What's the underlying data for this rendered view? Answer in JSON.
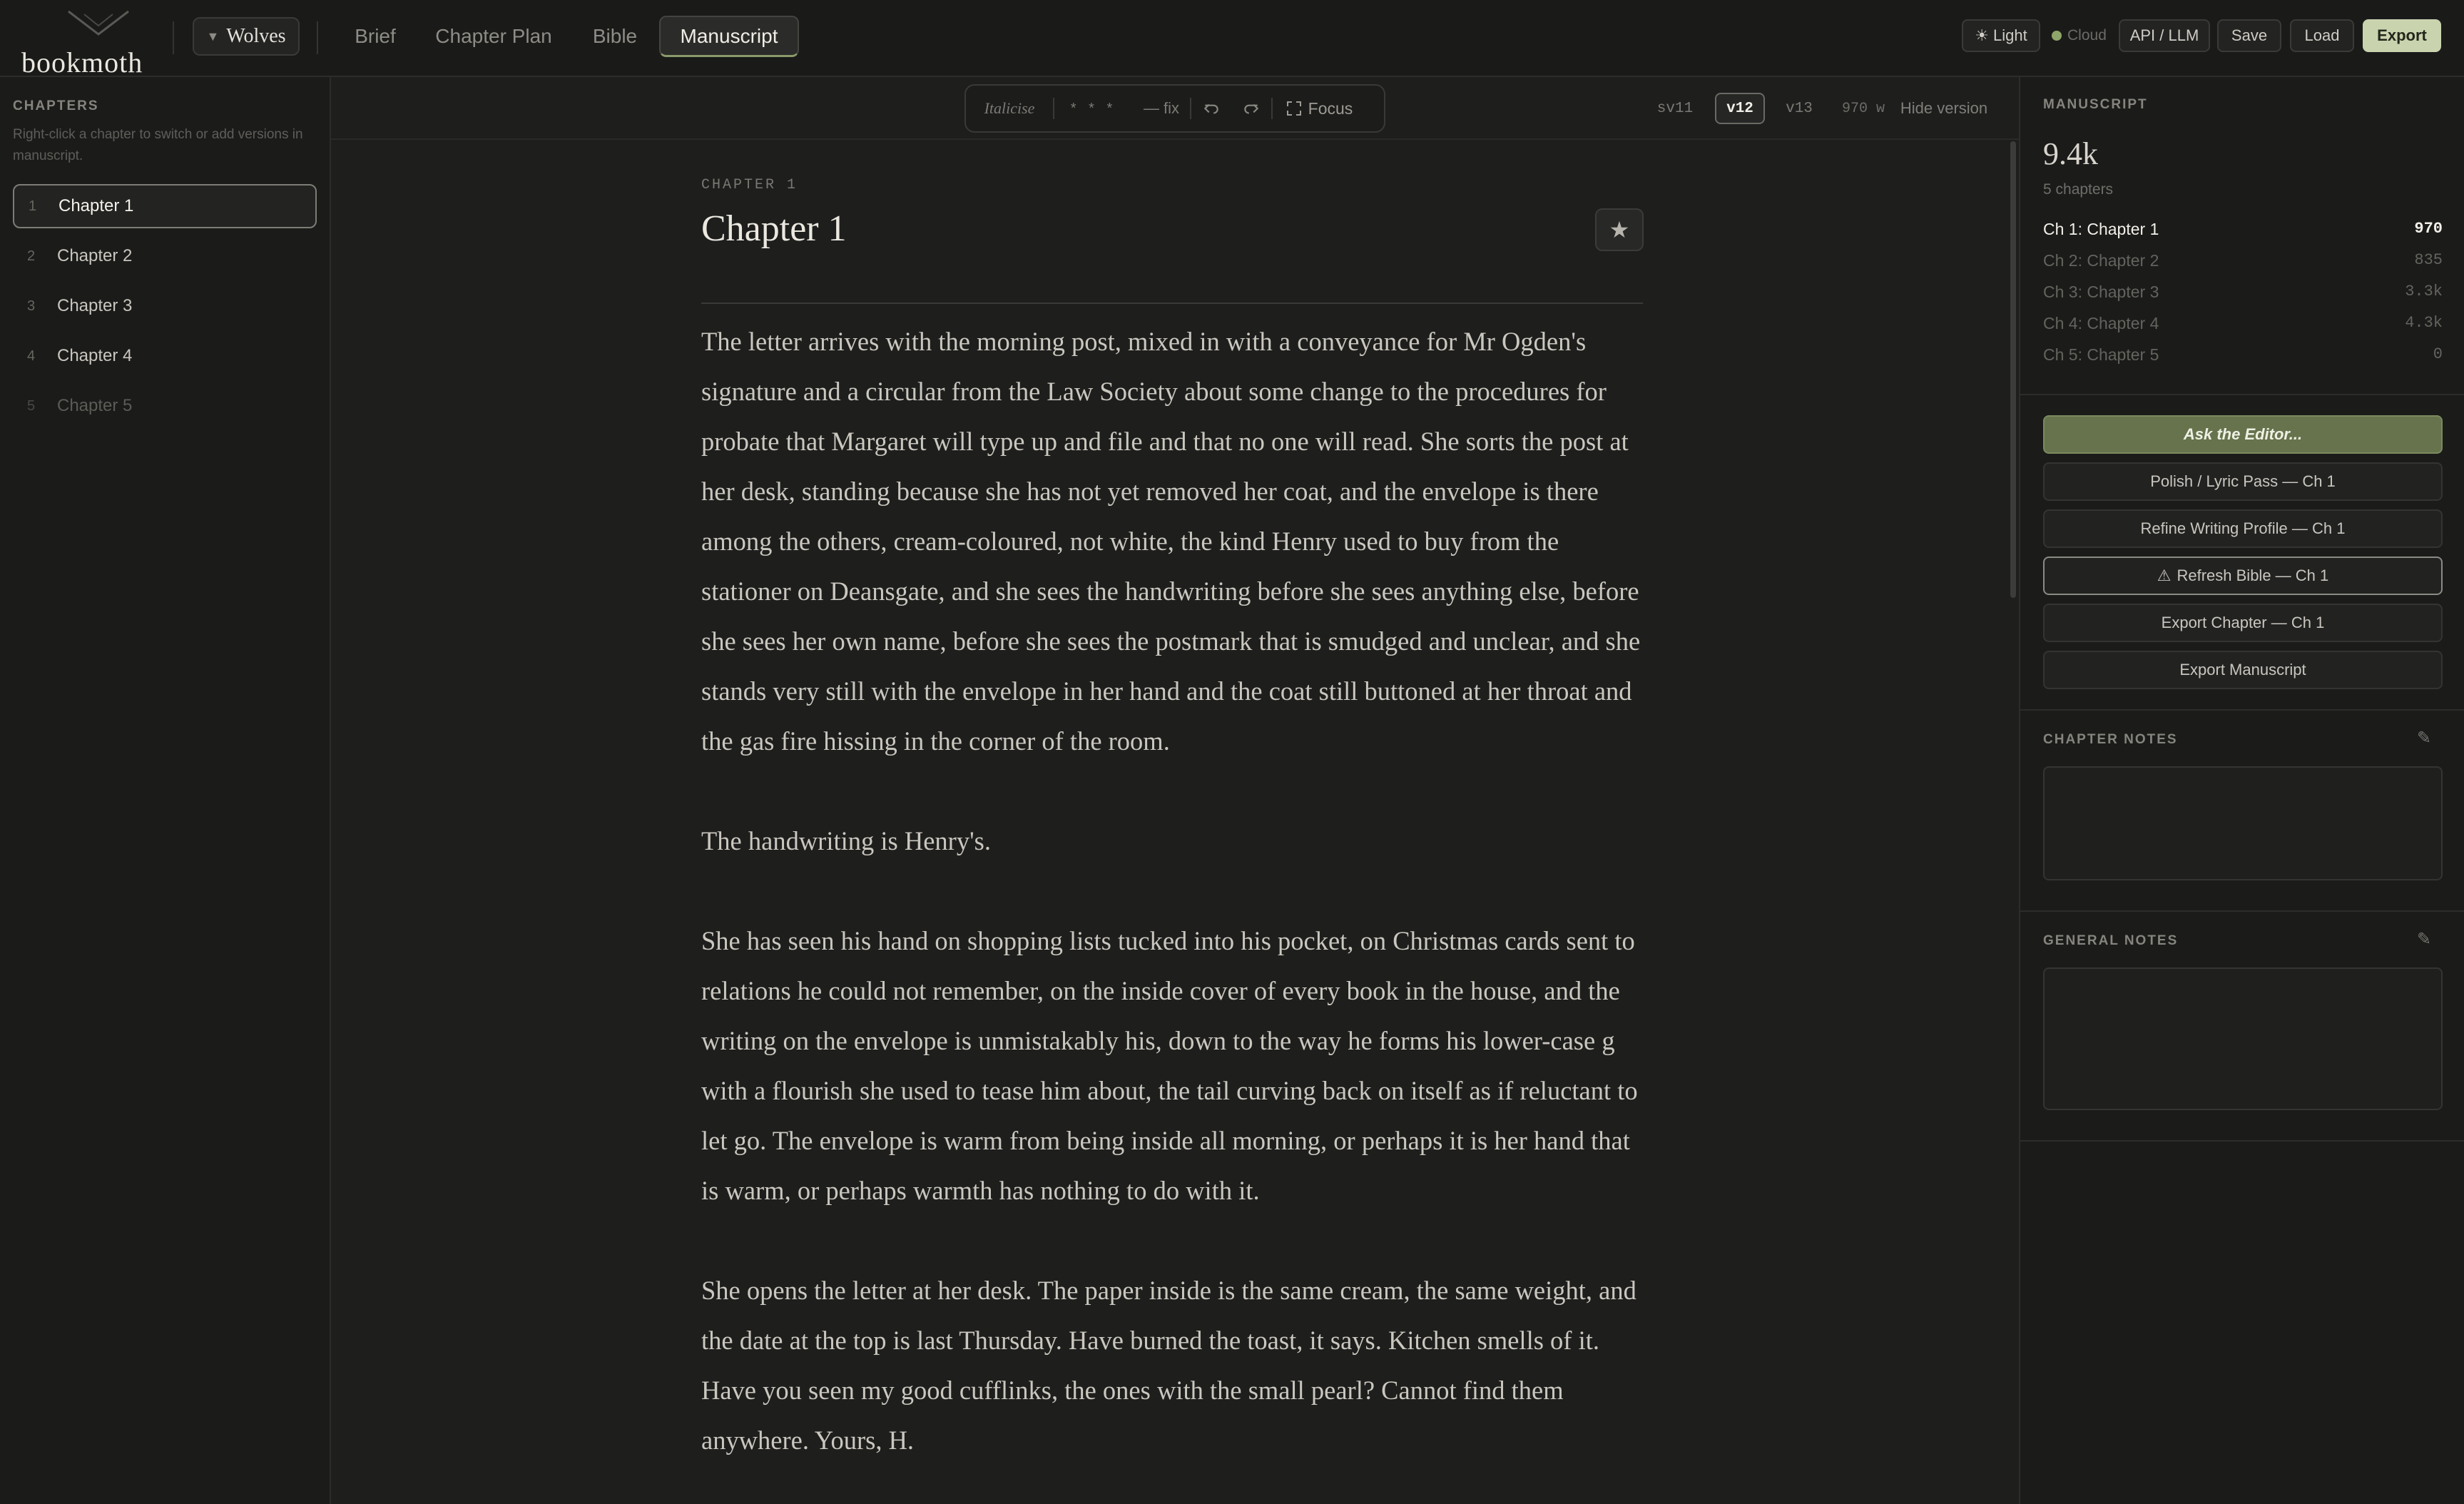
{
  "app": {
    "logo_text": "bookmoth"
  },
  "project": {
    "name": "Wolves"
  },
  "nav": {
    "tabs": [
      {
        "label": "Brief"
      },
      {
        "label": "Chapter Plan"
      },
      {
        "label": "Bible"
      },
      {
        "label": "Manuscript"
      }
    ]
  },
  "header_actions": {
    "light": "Light",
    "cloud": "Cloud",
    "api": "API / LLM",
    "save": "Save",
    "load": "Load",
    "export": "Export"
  },
  "sidebar": {
    "title": "CHAPTERS",
    "hint": "Right-click a chapter to switch or add versions in manuscript.",
    "chapters": [
      {
        "num": "1",
        "label": "Chapter 1"
      },
      {
        "num": "2",
        "label": "Chapter 2"
      },
      {
        "num": "3",
        "label": "Chapter 3"
      },
      {
        "num": "4",
        "label": "Chapter 4"
      },
      {
        "num": "5",
        "label": "Chapter 5"
      }
    ]
  },
  "toolbar": {
    "italicise": "Italicise",
    "scene_break": "* * *",
    "dash_fix": "— fix",
    "focus": "Focus",
    "versions": [
      "sv11",
      "v12",
      "v13"
    ],
    "word_count": "970 w",
    "hide_version": "Hide version"
  },
  "editor": {
    "kicker": "CHAPTER 1",
    "title": "Chapter 1",
    "paragraphs": [
      "The letter arrives with the morning post, mixed in with a conveyance for Mr Ogden's signature and a circular from the Law Society about some change to the procedures for probate that Margaret will type up and file and that no one will read. She sorts the post at her desk, standing because she has not yet removed her coat, and the envelope is there among the others, cream-coloured, not white, the kind Henry used to buy from the stationer on Deansgate, and she sees the handwriting before she sees anything else, before she sees her own name, before she sees the postmark that is smudged and unclear, and she stands very still with the envelope in her hand and the coat still buttoned at her throat and the gas fire hissing in the corner of the room.",
      "The handwriting is Henry's.",
      "She has seen his hand on shopping lists tucked into his pocket, on Christmas cards sent to relations he could not remember, on the inside cover of every book in the house, and the writing on the envelope is unmistakably his, down to the way he forms his lower-case g with a flourish she used to tease him about, the tail curving back on itself as if reluctant to let go. The envelope is warm from being inside all morning, or perhaps it is her hand that is warm, or perhaps warmth has nothing to do with it.",
      "She opens the letter at her desk. The paper inside is the same cream, the same weight, and the date at the top is last Thursday. Have burned the toast, it says. Kitchen smells of it. Have you seen my good cufflinks, the ones with the small pearl? Cannot find them anywhere. Yours, H."
    ]
  },
  "manuscript_panel": {
    "title": "MANUSCRIPT",
    "total_words": "9.4k",
    "chapter_count": "5 chapters",
    "rows": [
      {
        "label": "Ch 1: Chapter 1",
        "words": "970"
      },
      {
        "label": "Ch 2: Chapter 2",
        "words": "835"
      },
      {
        "label": "Ch 3: Chapter 3",
        "words": "3.3k"
      },
      {
        "label": "Ch 4: Chapter 4",
        "words": "4.3k"
      },
      {
        "label": "Ch 5: Chapter 5",
        "words": "0"
      }
    ],
    "actions": {
      "ask": "Ask the Editor...",
      "polish": "Polish / Lyric Pass — Ch 1",
      "refine": "Refine Writing Profile — Ch 1",
      "refresh": "Refresh Bible — Ch 1",
      "export_chapter": "Export Chapter — Ch 1",
      "export_manuscript": "Export Manuscript"
    },
    "chapter_notes_title": "CHAPTER NOTES",
    "general_notes_title": "GENERAL NOTES"
  },
  "colors": {
    "accent": "#66734d",
    "export_button": "#c9d3ae",
    "cloud_status": "#8fa66a"
  },
  "icons": [
    "logo-mark-icon",
    "triangle-down-icon",
    "sun-icon",
    "undo-icon",
    "redo-icon",
    "focus-expand-icon",
    "star-icon",
    "warning-icon",
    "pencil-icon"
  ]
}
